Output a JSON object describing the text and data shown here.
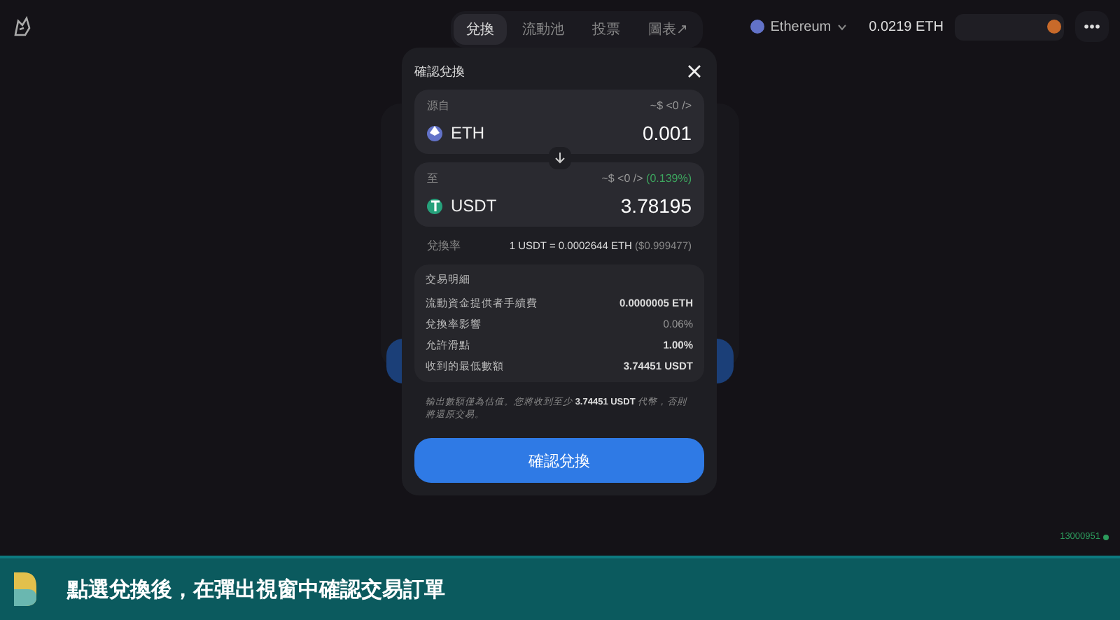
{
  "nav": {
    "tabs": [
      {
        "label": "兌換",
        "selected": true
      },
      {
        "label": "流動池",
        "selected": false
      },
      {
        "label": "投票",
        "selected": false
      },
      {
        "label": "圖表↗",
        "selected": false
      }
    ]
  },
  "network": {
    "name": "Ethereum",
    "balance": "0.0219 ETH"
  },
  "dialog": {
    "title": "確認兌換",
    "from": {
      "label": "源自",
      "usd": "~$ <0 />",
      "token": "ETH",
      "amount": "0.001"
    },
    "to": {
      "label": "至",
      "usd": "~$ <0 />",
      "impact": "(0.139%)",
      "token": "USDT",
      "amount": "3.78195"
    },
    "rate": {
      "label": "兌換率",
      "value": "1 USDT = 0.0002644 ETH",
      "usd": "($0.999477)"
    },
    "details": {
      "title": "交易明細",
      "rows": [
        {
          "label": "流動資金提供者手續費",
          "value": "0.0000005 ETH",
          "bold": true
        },
        {
          "label": "兌換率影響",
          "value": "0.06%",
          "bold": false
        },
        {
          "label": "允許滑點",
          "value": "1.00%",
          "bold": true
        },
        {
          "label": "收到的最低數額",
          "value": "3.74451 USDT",
          "bold": true
        }
      ]
    },
    "note": "輸出數額僅為估值。您將收到至少 **3.74451 USDT** 代幣，否則將還原交易。",
    "confirm": "確認兌換"
  },
  "block": "13000951",
  "caption": "點選兌換後，在彈出視窗中確認交易訂單"
}
